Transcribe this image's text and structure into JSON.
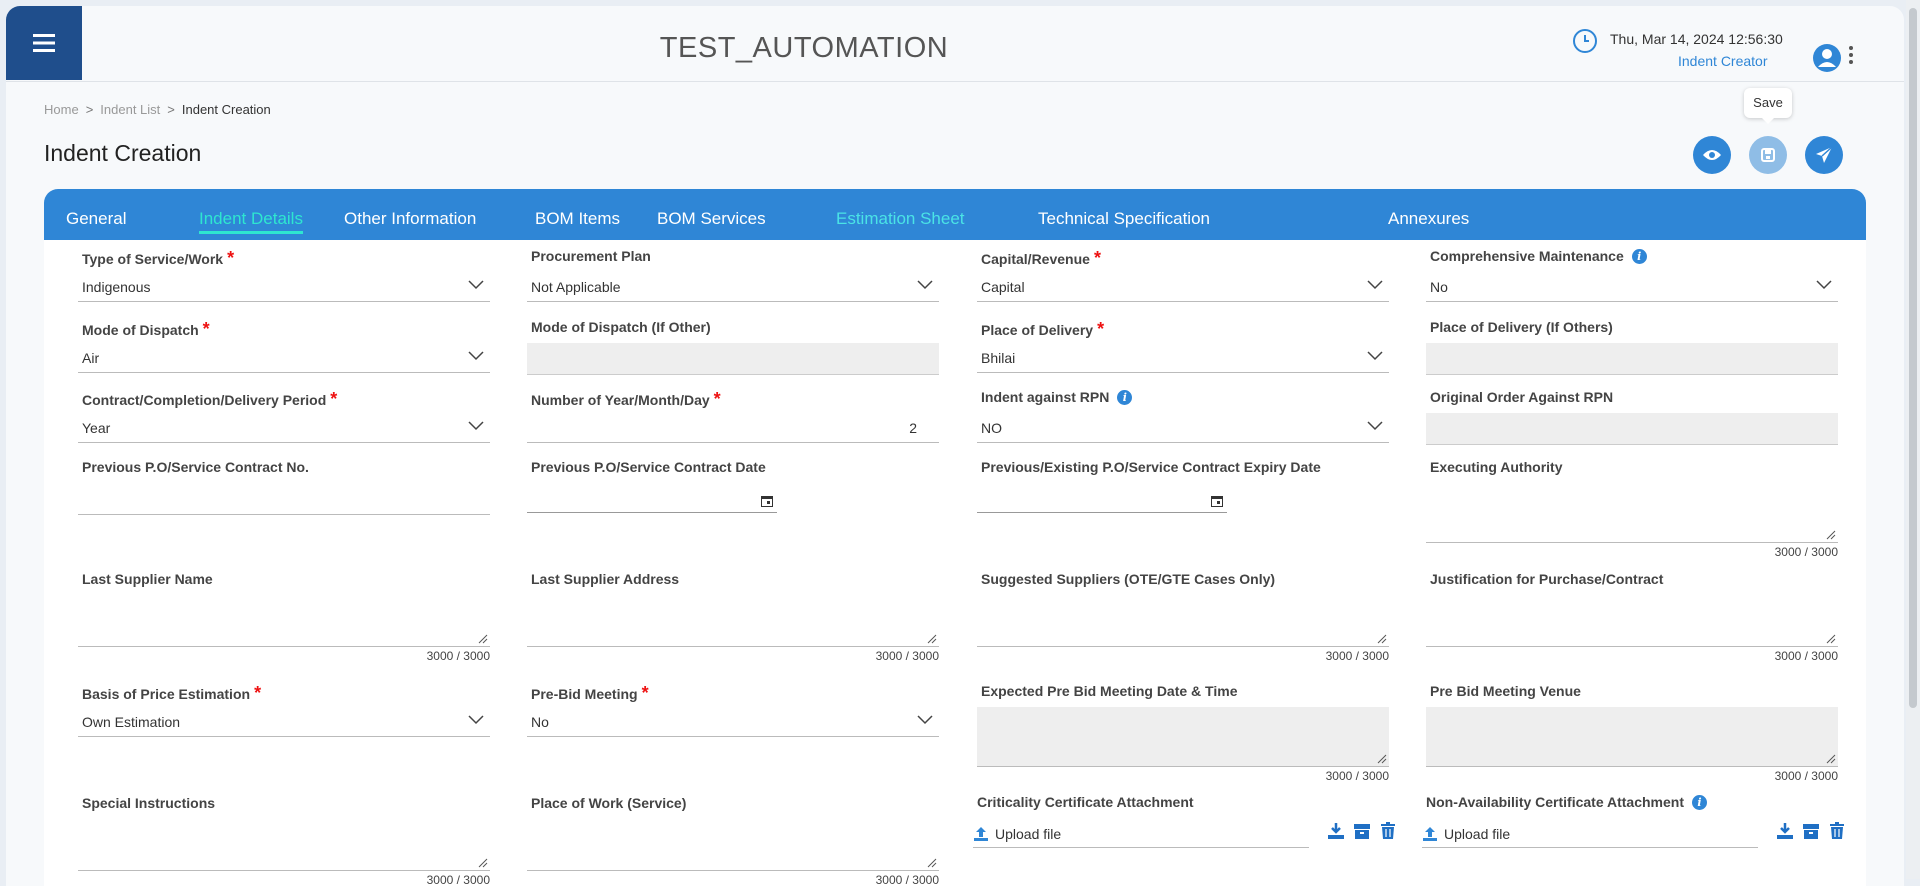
{
  "app": {
    "title": "TEST_AUTOMATION",
    "datetime": "Thu, Mar 14, 2024 12:56:30",
    "role": "Indent Creator"
  },
  "breadcrumb": {
    "home": "Home",
    "sep1": ">",
    "list": "Indent List",
    "sep2": ">",
    "current": "Indent Creation"
  },
  "page": {
    "title": "Indent Creation"
  },
  "tooltip": {
    "save": "Save"
  },
  "actions": {
    "view_icon": "eye-icon",
    "save_icon": "save-icon",
    "submit_icon": "paper-plane-icon"
  },
  "colors": {
    "primary": "#2f86d6",
    "menu": "#1f4e8c",
    "active_tab": "#2ee6d0",
    "required": "#e11111"
  },
  "tabs": [
    "General",
    "Indent Details",
    "Other Information",
    "BOM Items",
    "BOM Services",
    "Estimation Sheet",
    "Technical Specification",
    "Annexures"
  ],
  "active_tab": "Indent Details",
  "fields": {
    "type_of_service": {
      "label": "Type of Service/Work",
      "value": "Indigenous"
    },
    "procurement_plan": {
      "label": "Procurement Plan",
      "value": "Not Applicable"
    },
    "capital_revenue": {
      "label": "Capital/Revenue",
      "value": "Capital"
    },
    "comprehensive_maintenance": {
      "label": "Comprehensive Maintenance",
      "value": "No"
    },
    "mode_of_dispatch": {
      "label": "Mode of Dispatch",
      "value": "Air"
    },
    "mode_of_dispatch_other": {
      "label": "Mode of Dispatch (If Other)"
    },
    "place_of_delivery": {
      "label": "Place of Delivery",
      "value": "Bhilai"
    },
    "place_of_delivery_others": {
      "label": "Place of Delivery (If Others)"
    },
    "delivery_period": {
      "label": "Contract/Completion/Delivery Period",
      "value": "Year"
    },
    "number_of_period": {
      "label": "Number of Year/Month/Day",
      "value": "2"
    },
    "indent_against_rpn": {
      "label": "Indent against RPN",
      "value": "NO"
    },
    "original_order_rpn": {
      "label": "Original Order Against RPN"
    },
    "prev_po_no": {
      "label": "Previous P.O/Service Contract No."
    },
    "prev_po_date": {
      "label": "Previous P.O/Service Contract Date"
    },
    "prev_po_expiry": {
      "label": "Previous/Existing P.O/Service Contract Expiry Date"
    },
    "executing_authority": {
      "label": "Executing Authority",
      "count": "3000 / 3000"
    },
    "last_supplier_name": {
      "label": "Last Supplier Name",
      "count": "3000 / 3000"
    },
    "last_supplier_address": {
      "label": "Last Supplier Address",
      "count": "3000 / 3000"
    },
    "suggested_suppliers": {
      "label": "Suggested Suppliers (OTE/GTE Cases Only)",
      "count": "3000 / 3000"
    },
    "justification": {
      "label": "Justification for Purchase/Contract",
      "count": "3000 / 3000"
    },
    "basis_of_price": {
      "label": "Basis of Price Estimation",
      "value": "Own Estimation"
    },
    "pre_bid_meeting": {
      "label": "Pre-Bid Meeting",
      "value": "No"
    },
    "pre_bid_datetime": {
      "label": "Expected Pre Bid Meeting Date & Time",
      "count": "3000 / 3000"
    },
    "pre_bid_venue": {
      "label": "Pre Bid Meeting Venue",
      "count": "3000 / 3000"
    },
    "special_instructions": {
      "label": "Special Instructions",
      "count": "3000 / 3000"
    },
    "place_of_work": {
      "label": "Place of Work (Service)",
      "count": "3000 / 3000"
    },
    "criticality_cert": {
      "label": "Criticality Certificate Attachment",
      "upload": "Upload file"
    },
    "non_availability_cert": {
      "label": "Non-Availability Certificate Attachment",
      "upload": "Upload file"
    }
  },
  "required_mark": "*",
  "info_glyph": "i"
}
